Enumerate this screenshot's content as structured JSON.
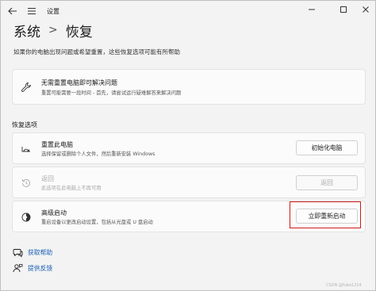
{
  "window": {
    "title": "设置"
  },
  "header": {
    "breadcrumb_parent": "系统",
    "breadcrumb_separator": ">",
    "breadcrumb_current": "恢复",
    "subtitle": "如果你的电脑出现问题或希望重置，这些恢复选项可能有所帮助"
  },
  "troubleshoot_card": {
    "title": "无需重置电脑即可解决问题",
    "description": "重置可能需要一段时间 - 首先，请尝试运行疑难解答来解决问题",
    "icon": "wrench-icon"
  },
  "recovery_section": {
    "label": "恢复选项",
    "items": [
      {
        "title": "重置此电脑",
        "description": "选择保留或删除个人文件，然后重新安装 Windows",
        "button": "初始化电脑",
        "icon": "reset-pc-icon",
        "enabled": true
      },
      {
        "title": "返回",
        "description": "此选项在此电脑上不再可用",
        "button": "返回",
        "icon": "history-icon",
        "enabled": false
      },
      {
        "title": "高级启动",
        "description": "重启设备以更改启动设置，包括从光盘或 U 盘启动",
        "button": "立即重新启动",
        "icon": "advanced-startup-icon",
        "enabled": true
      }
    ]
  },
  "links": [
    {
      "label": "获取帮助",
      "icon": "help-chat-icon"
    },
    {
      "label": "提供反馈",
      "icon": "feedback-icon"
    }
  ],
  "watermark": "CSDN @fubo1214",
  "colors": {
    "background": "#f3f3f3",
    "card": "#fbfbfb",
    "link": "#1a5fb4",
    "highlight": "#d11a1a"
  }
}
